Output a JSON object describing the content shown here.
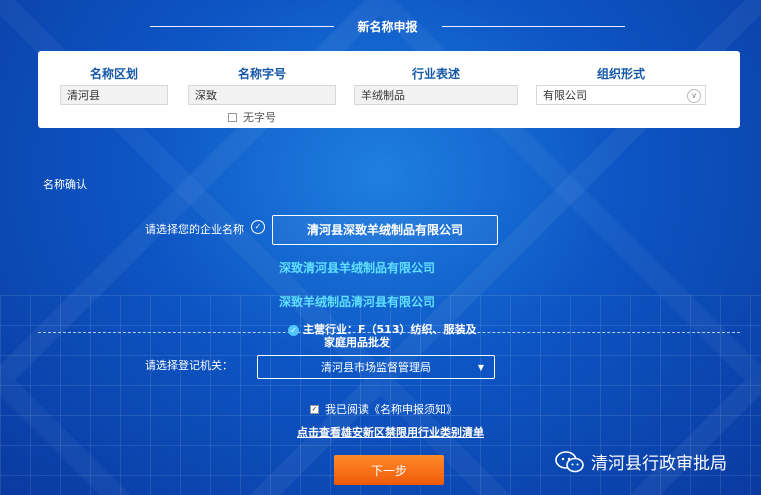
{
  "header": {
    "title": "新名称申报"
  },
  "form": {
    "fields": [
      {
        "label": "名称区划",
        "value": "清河县"
      },
      {
        "label": "名称字号",
        "value": "深致"
      },
      {
        "label": "行业表述",
        "value": "羊绒制品"
      },
      {
        "label": "组织形式",
        "value": "有限公司"
      }
    ],
    "no_char_label": "无字号"
  },
  "section": {
    "confirm_label": "名称确认"
  },
  "name_select": {
    "label": "请选择您的企业名称",
    "options": [
      "清河县深致羊绒制品有限公司",
      "深致清河县羊绒制品有限公司",
      "深致羊绒制品清河县有限公司"
    ],
    "selected_index": 0
  },
  "industry": {
    "line1": "主营行业：F（513）纺织、服装及",
    "line2": "家庭用品批发"
  },
  "registration": {
    "label": "请选择登记机关：",
    "selected": "清河县市场监督管理局"
  },
  "agreement": {
    "label": "我已阅读《名称申报须知》",
    "checked": true
  },
  "restricted_link": "点击查看雄安新区禁限用行业类别清单",
  "next_button": "下一步",
  "watermark": {
    "text": "清河县行政审批局",
    "icon": "wechat-icon"
  }
}
